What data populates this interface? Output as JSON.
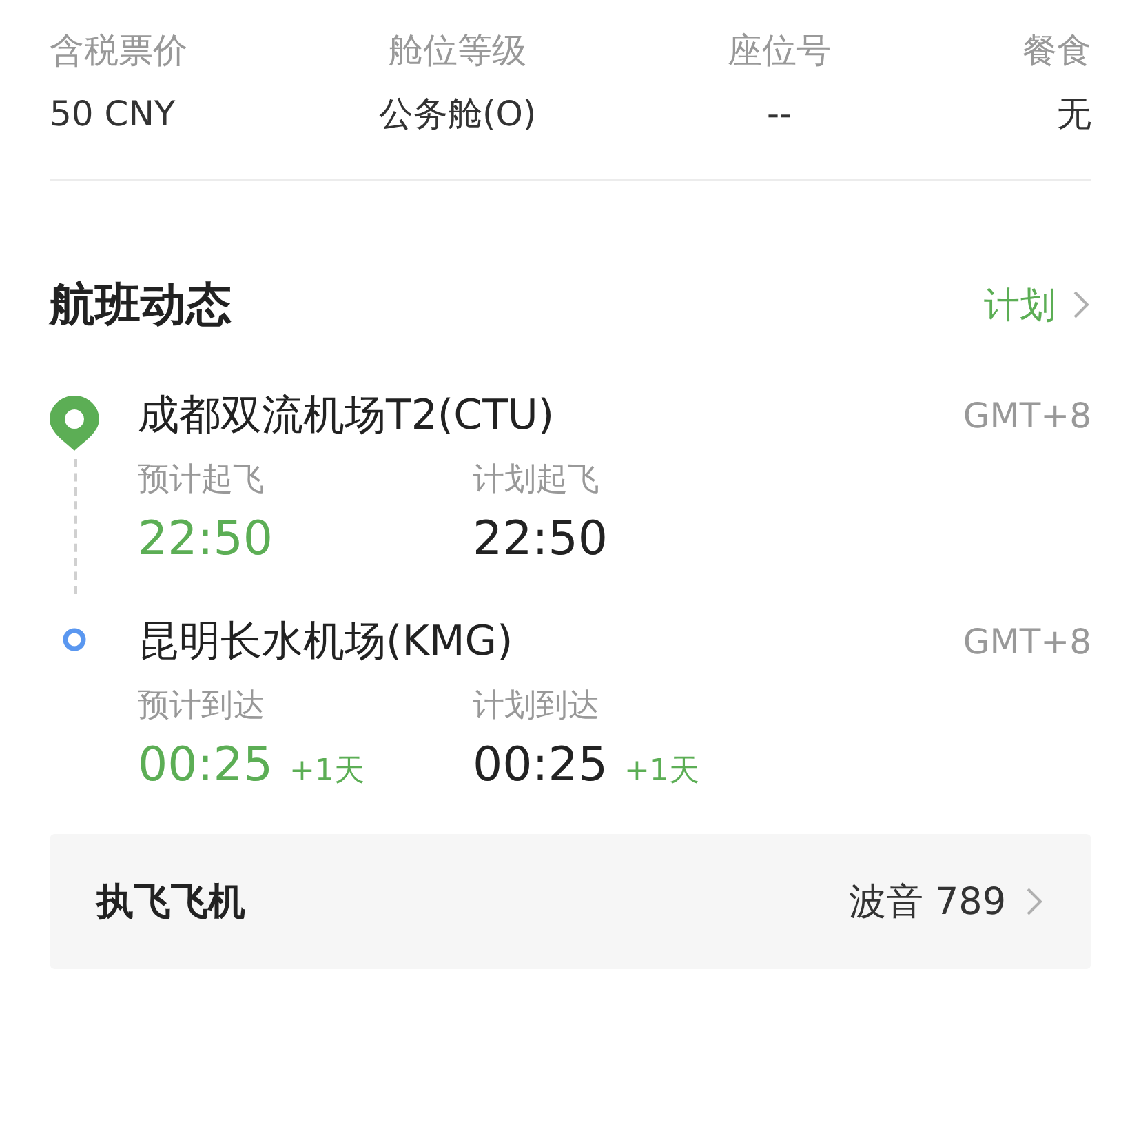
{
  "ticket_info": [
    {
      "label": "含税票价",
      "value": "50 CNY"
    },
    {
      "label": "舱位等级",
      "value": "公务舱(O)"
    },
    {
      "label": "座位号",
      "value": "--"
    },
    {
      "label": "餐食",
      "value": "无"
    }
  ],
  "flight_status": {
    "title": "航班动态",
    "status_link": "计划",
    "stops": [
      {
        "kind": "departure",
        "airport": "成都双流机场T2(CTU)",
        "timezone": "GMT+8",
        "times": [
          {
            "kind": "estimated",
            "label": "预计起飞",
            "time": "22:50"
          },
          {
            "kind": "scheduled",
            "label": "计划起飞",
            "time": "22:50"
          }
        ]
      },
      {
        "kind": "arrival",
        "airport": "昆明长水机场(KMG)",
        "timezone": "GMT+8",
        "times": [
          {
            "kind": "estimated",
            "label": "预计到达",
            "time": "00:25",
            "day_offset": "+1天"
          },
          {
            "kind": "scheduled",
            "label": "计划到达",
            "time": "00:25",
            "day_offset": "+1天"
          }
        ]
      }
    ]
  },
  "aircraft": {
    "label": "执飞飞机",
    "value": "波音 789"
  }
}
